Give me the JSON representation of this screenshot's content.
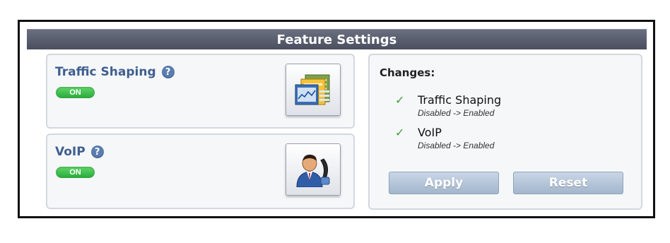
{
  "header": {
    "title": "Feature Settings"
  },
  "features": [
    {
      "title": "Traffic Shaping",
      "help": "?",
      "toggle": "ON",
      "icon": "chart-window-icon"
    },
    {
      "title": "VoIP",
      "help": "?",
      "toggle": "ON",
      "icon": "user-phone-icon"
    }
  ],
  "changes": {
    "title": "Changes:",
    "items": [
      {
        "name": "Traffic Shaping",
        "detail": "Disabled -> Enabled"
      },
      {
        "name": "VoIP",
        "detail": "Disabled -> Enabled"
      }
    ],
    "apply_label": "Apply",
    "reset_label": "Reset"
  },
  "colors": {
    "header_bg": "#55596a",
    "feature_title": "#3e5f8f",
    "toggle_on": "#2aa83a",
    "check": "#3aa03a",
    "button_bg": "#b3c4d8"
  }
}
